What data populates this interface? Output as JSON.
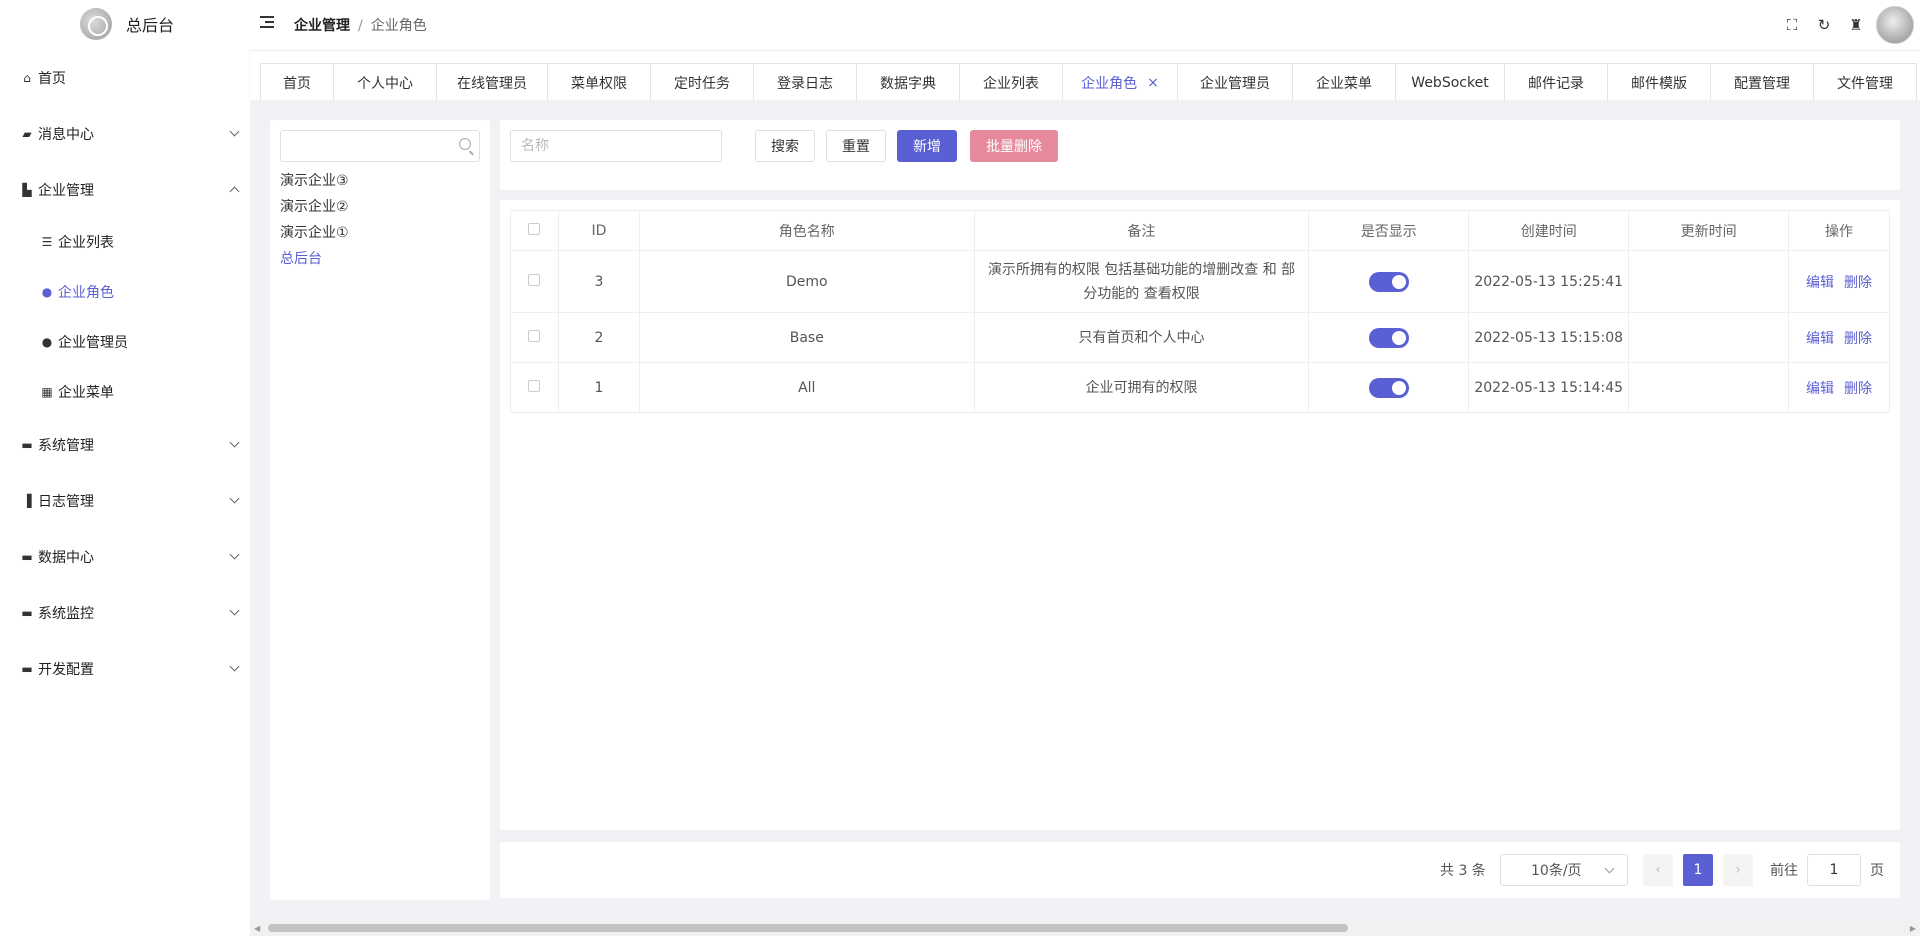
{
  "app": {
    "title": "总后台"
  },
  "header": {
    "breadcrumb": [
      "企业管理",
      "企业角色"
    ],
    "separator": "/",
    "icons": [
      "fullscreen-icon",
      "refresh-icon",
      "broom-icon"
    ]
  },
  "sidebar": {
    "items": [
      {
        "label": "首页",
        "icon": "home-icon"
      },
      {
        "label": "消息中心",
        "icon": "chat-icon"
      },
      {
        "label": "企业管理",
        "icon": "chart-icon"
      },
      {
        "label": "企业列表",
        "icon": "list-icon"
      },
      {
        "label": "企业角色",
        "icon": "user-group-icon"
      },
      {
        "label": "企业管理员",
        "icon": "user-icon"
      },
      {
        "label": "企业菜单",
        "icon": "grid-icon"
      },
      {
        "label": "系统管理",
        "icon": "monitor-icon"
      },
      {
        "label": "日志管理",
        "icon": "log-icon"
      },
      {
        "label": "数据中心",
        "icon": "monitor-icon"
      },
      {
        "label": "系统监控",
        "icon": "monitor-icon"
      },
      {
        "label": "开发配置",
        "icon": "monitor-icon"
      }
    ]
  },
  "tabs": [
    "首页",
    "个人中心",
    "在线管理员",
    "菜单权限",
    "定时任务",
    "登录日志",
    "数据字典",
    "企业列表",
    "企业角色",
    "企业管理员",
    "企业菜单",
    "WebSocket",
    "邮件记录",
    "邮件模版",
    "配置管理",
    "文件管理"
  ],
  "active_tab_close": "×",
  "tree": {
    "search_value": "",
    "items": [
      "演示企业③",
      "演示企业②",
      "演示企业①",
      "总后台"
    ]
  },
  "search": {
    "placeholder": "名称",
    "search_label": "搜索",
    "reset_label": "重置",
    "add_label": "新增",
    "batch_delete_label": "批量删除"
  },
  "table": {
    "headers": [
      "ID",
      "角色名称",
      "备注",
      "是否显示",
      "创建时间",
      "更新时间",
      "操作"
    ],
    "rows": [
      {
        "id": "3",
        "name": "Demo",
        "remark": "演示所拥有的权限 包括基础功能的增删改查 和 部分功能的 查看权限",
        "show": true,
        "created": "2022-05-13 15:25:41",
        "updated": "",
        "edit": "编辑",
        "delete": "删除"
      },
      {
        "id": "2",
        "name": "Base",
        "remark": "只有首页和个人中心",
        "show": true,
        "created": "2022-05-13 15:15:08",
        "updated": "",
        "edit": "编辑",
        "delete": "删除"
      },
      {
        "id": "1",
        "name": "All",
        "remark": "企业可拥有的权限",
        "show": true,
        "created": "2022-05-13 15:14:45",
        "updated": "",
        "edit": "编辑",
        "delete": "删除"
      }
    ]
  },
  "pagination": {
    "total_text": "共 3 条",
    "page_size": "10条/页",
    "current_page": "1",
    "goto_label": "前往",
    "goto_value": "1",
    "page_unit": "页"
  },
  "colors": {
    "accent": "#5a5fd4",
    "danger_button": "#e5899b",
    "background": "#f0f2f5"
  }
}
